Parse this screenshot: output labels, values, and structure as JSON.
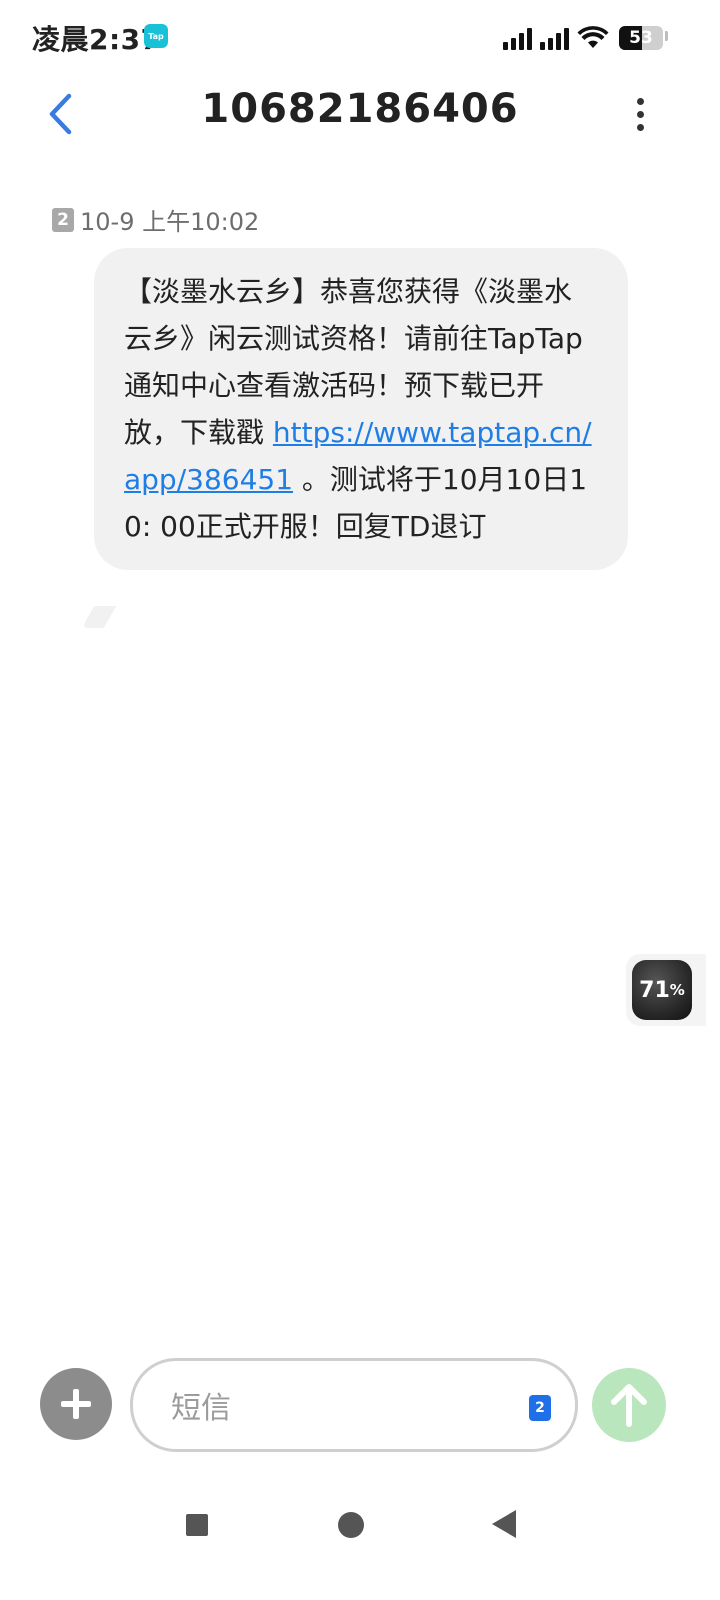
{
  "status_bar": {
    "time": "凌晨2:37",
    "app_badge": "Tap",
    "battery_level": "53"
  },
  "header": {
    "title": "10682186406"
  },
  "message": {
    "sim_slot": "2",
    "timestamp": "10-9 上午10:02",
    "text_before_link": "【淡墨水云乡】恭喜您获得《淡墨水云乡》闲云测试资格！请前往TapTap通知中心查看激活码！预下载已开放，下载戳 ",
    "link": "https://www.taptap.cn/app/386451",
    "text_after_link": " 。测试将于10月10日10: 00正式开服！回复TD退订"
  },
  "floating_widget": {
    "percent_value": "71",
    "percent_sign": "%"
  },
  "composer": {
    "placeholder": "短信",
    "sim_slot": "2"
  },
  "icons": {
    "back": "back-chevron-icon",
    "more": "more-vertical-icon",
    "plus": "plus-icon",
    "send": "send-arrow-icon",
    "wifi": "wifi-icon",
    "signal": "signal-icon",
    "battery": "battery-icon"
  },
  "colors": {
    "accent": "#1f7ee6",
    "back_icon": "#3a7be0",
    "send_button": "#b9e6bd",
    "bubble": "#f1f1f1"
  }
}
